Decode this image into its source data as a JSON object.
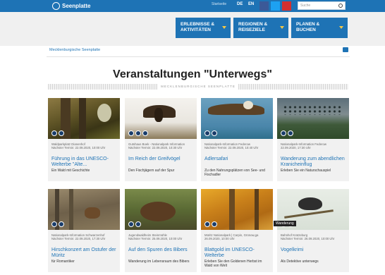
{
  "header": {
    "logo_text": "Seenplatte",
    "topbar_text": "Startseite",
    "lang_1": "DE",
    "lang_2": "EN",
    "search_placeholder": "Suche",
    "colors": {
      "brand": "#1e73b5",
      "accent": "#f6c744"
    }
  },
  "nav": [
    {
      "line1": "ERLEBNISSE &",
      "line2": "AKTIVITÄTEN"
    },
    {
      "line1": "REGIONEN &",
      "line2": "REISEZIELE"
    },
    {
      "line1": "PLANEN &",
      "line2": "BUCHEN"
    }
  ],
  "breadcrumb": "Mecklenburgische Seenplatte",
  "page": {
    "title": "Veranstaltungen \"Unterwegs\"",
    "subtitle": "MECKLENBURGISCHE SEENPLATTE"
  },
  "cards": [
    {
      "location": "Waldparkplatz Dianenhof",
      "date": "Nächster Termin: 22.09.2020, 10:00 Uhr",
      "title": "Führung in das UNESCO-Welterbe \"Alte...",
      "desc": "Ein Wald mit Geschichte"
    },
    {
      "location": "Gutshaus Boek - Nationalpark Information",
      "date": "Nächster Termin: 22.09.2020, 10:30 Uhr",
      "title": "Im Reich der Greifvögel",
      "desc": "Den Fischjägern auf der Spur"
    },
    {
      "location": "Nationalpark-Information Federow",
      "date": "Nächster Termin: 22.09.2020, 10:40 Uhr",
      "title": "Adlersafari",
      "desc": "Zu den Nahrungsplätzen von See- und Fischadler"
    },
    {
      "location": "Nationalpark-Information Federow",
      "date": "22.09.2020, 17:30 Uhr",
      "title": "Wanderung zum abendlichen Kranicheinflug",
      "desc": "Erleben Sie ein Naturschauspiel"
    },
    {
      "location": "Nationalpark-Information Schwarzenhof",
      "date": "Nächster Termin: 22.09.2020, 17:30 Uhr",
      "title": "Hirschkonzert am Ostufer der Müritz",
      "desc": "für Romantiker"
    },
    {
      "location": "Jugendwaldheim Steinmühle",
      "date": "Nächster Termin: 25.09.2020, 10:00 Uhr",
      "title": "Auf den Spuren des Bibers",
      "desc": "Wanderung im Lebensraum des Bibers"
    },
    {
      "location": "Müritz Nationalpark | Carpin, Grünow,ga",
      "date": "26.09.2020, 10:00 Uhr",
      "title": "Blattgold im UNESCO-Welterbe",
      "desc": "Erleben Sie den Goldenen Herbst im Wald von Welt"
    },
    {
      "location": "Bahnhof Kratzeburg",
      "date": "Nächster Termin: 26.09.2020, 10:00 Uhr",
      "title": "Vogelkrimi",
      "desc": "Als Detektive unterwegs"
    }
  ],
  "tooltip": "Wanderung"
}
